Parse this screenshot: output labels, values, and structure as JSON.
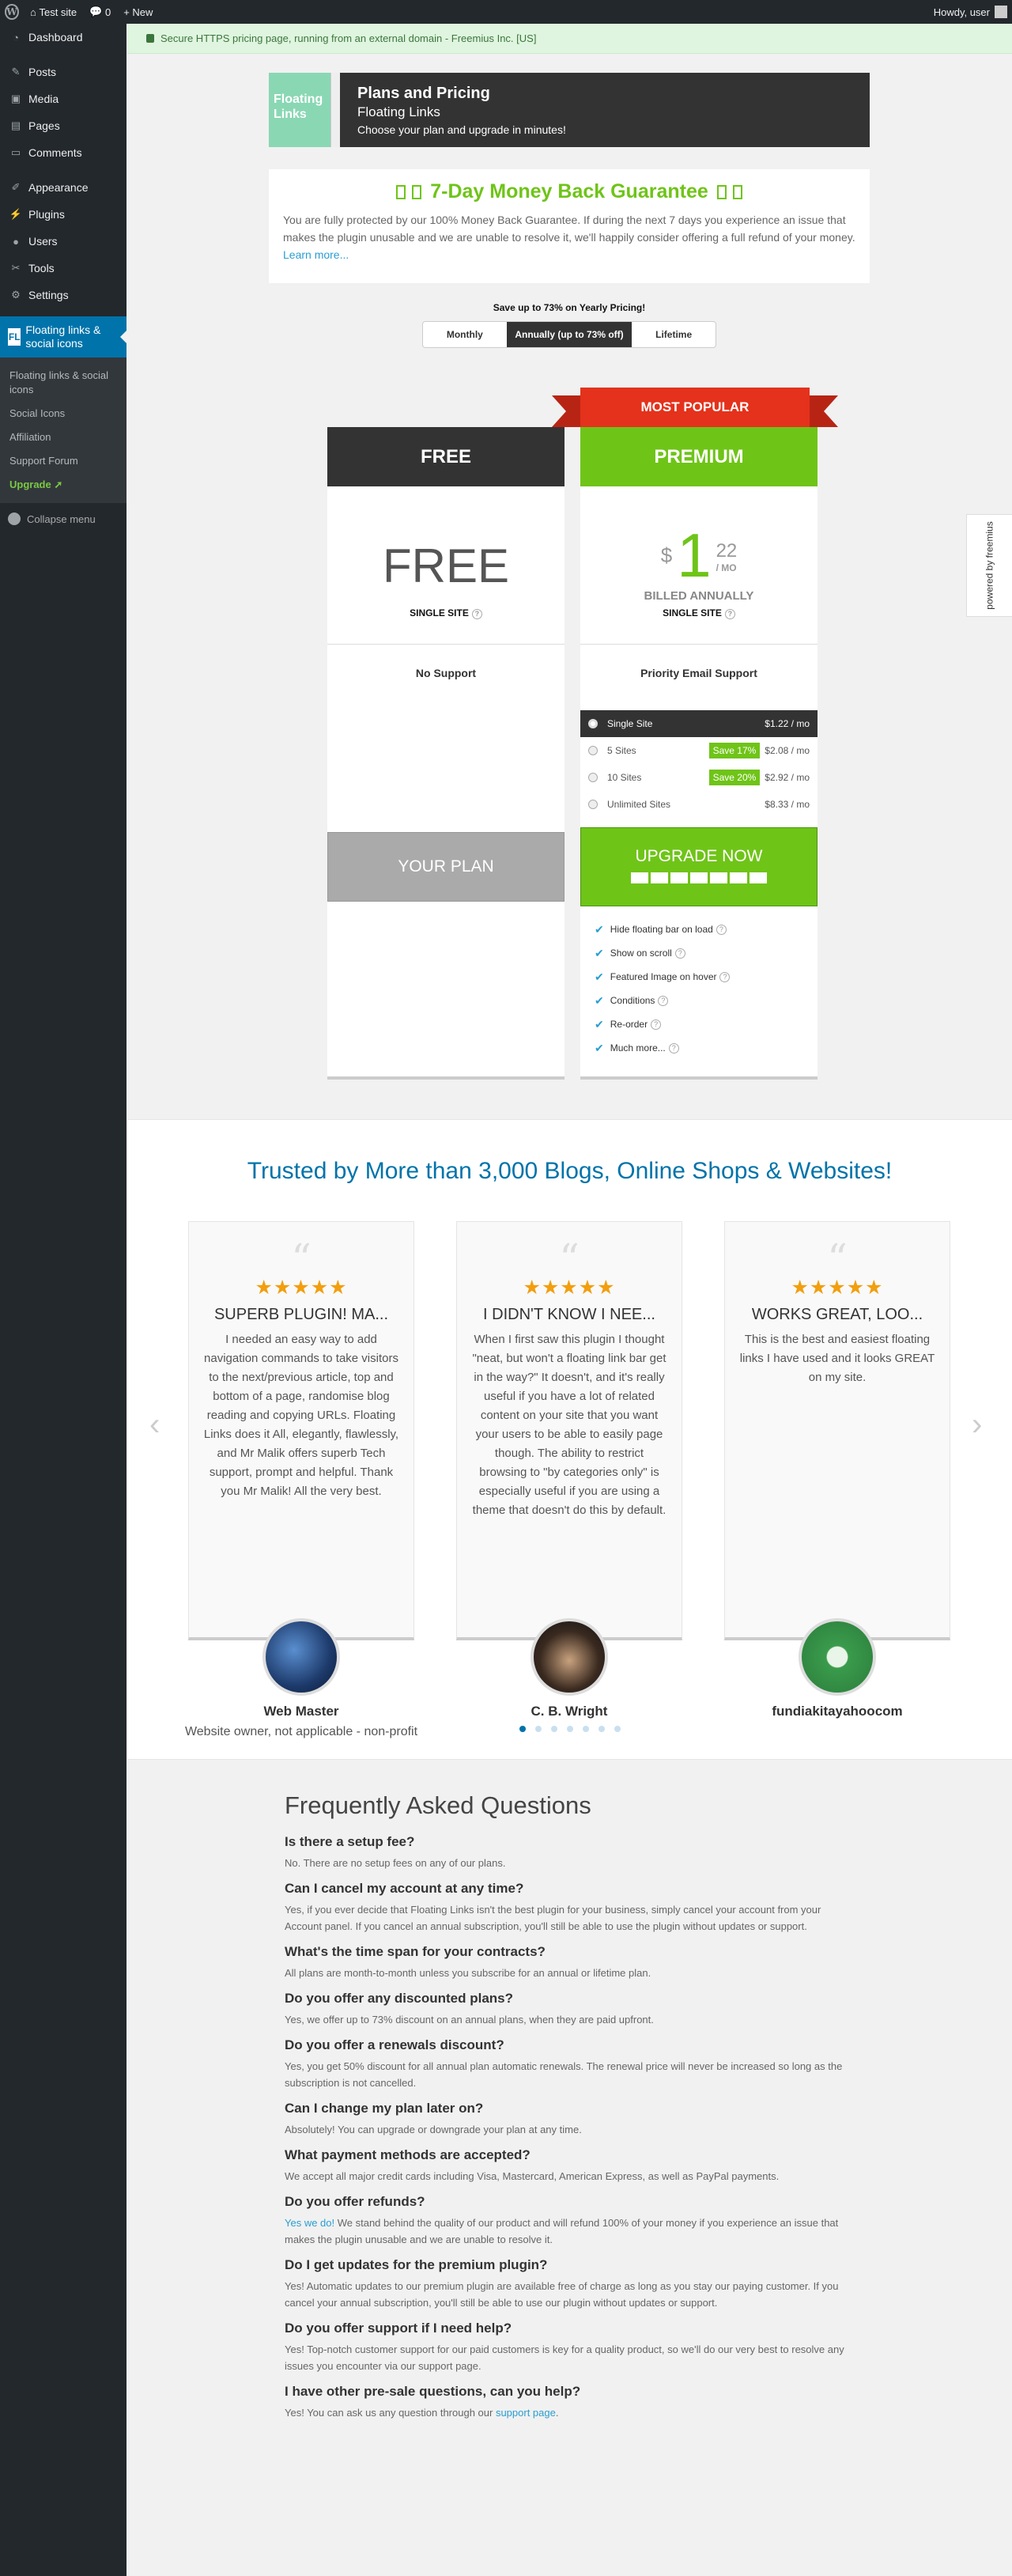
{
  "adminbar": {
    "site": "Test site",
    "comments": "0",
    "new": "New",
    "howdy": "Howdy, user"
  },
  "menu": {
    "dashboard": "Dashboard",
    "posts": "Posts",
    "media": "Media",
    "pages": "Pages",
    "comments": "Comments",
    "appearance": "Appearance",
    "plugins": "Plugins",
    "users": "Users",
    "tools": "Tools",
    "settings": "Settings",
    "fl_icon": "FL",
    "fl_label": "Floating links & social icons",
    "sub": [
      "Floating links & social icons",
      "Social Icons",
      "Affiliation",
      "Support Forum"
    ],
    "upgrade": "Upgrade",
    "collapse": "Collapse menu"
  },
  "secure": "Secure HTTPS pricing page, running from an external domain - Freemius Inc. [US]",
  "header": {
    "logo_text": "Floating Links",
    "title": "Plans and Pricing",
    "subtitle": "Floating Links",
    "tagline": "Choose your plan and upgrade in minutes!"
  },
  "guarantee": {
    "title": "7-Day Money Back Guarantee",
    "text": "You are fully protected by our 100% Money Back Guarantee. If during the next 7 days you experience an issue that makes the plugin unusable and we are unable to resolve it, we'll happily consider offering a full refund of your money.",
    "link": "Learn more..."
  },
  "billing": {
    "save": "Save up to 73% on Yearly Pricing!",
    "options": [
      "Monthly",
      "Annually (up to 73% off)",
      "Lifetime"
    ]
  },
  "ribbon": "MOST POPULAR",
  "free": {
    "name": "FREE",
    "price": "FREE",
    "sites": "SINGLE SITE",
    "support": "No Support",
    "button": "YOUR PLAN"
  },
  "premium": {
    "name": "PREMIUM",
    "currency": "$",
    "price_int": "1",
    "price_dec": "22",
    "per": "/ MO",
    "billed": "BILLED ANNUALLY",
    "sites": "SINGLE SITE",
    "support": "Priority Email Support",
    "button": "UPGRADE NOW",
    "site_options": [
      {
        "name": "Single Site",
        "save": "",
        "price": "$1.22 / mo"
      },
      {
        "name": "5 Sites",
        "save": "Save 17%",
        "price": "$2.08 / mo"
      },
      {
        "name": "10 Sites",
        "save": "Save 20%",
        "price": "$2.92 / mo"
      },
      {
        "name": "Unlimited Sites",
        "save": "",
        "price": "$8.33 / mo"
      }
    ],
    "features": [
      "Hide floating bar on load",
      "Show on scroll",
      "Featured Image on hover",
      "Conditions",
      "Re-order",
      "Much more..."
    ]
  },
  "powered": "powered by freemius",
  "trusted": {
    "title": "Trusted by More than 3,000 Blogs, Online Shops & Websites!",
    "stars": "★★★★★",
    "cards": [
      {
        "title": "SUPERB PLUGIN! MA...",
        "text": "I needed an easy way to add navigation commands to take visitors to the next/previous article, top and bottom of a page, randomise blog reading and copying URLs. Floating Links does it All, elegantly, flawlessly, and Mr Malik offers superb Tech support, prompt and helpful. Thank you Mr Malik! All the very best.",
        "name": "Web Master",
        "sub": "Website owner, not applicable - non-profit"
      },
      {
        "title": "I DIDN'T KNOW I NEE...",
        "text": "When I first saw this plugin I thought \"neat, but won't a floating link bar get in the way?\" It doesn't, and it's really useful if you have a lot of related content on your site that you want your users to be able to easily page though. The ability to restrict browsing to \"by categories only\" is especially useful if you are using a theme that doesn't do this by default.",
        "name": "C. B. Wright",
        "sub": ""
      },
      {
        "title": "WORKS GREAT, LOO...",
        "text": "This is the best and easiest floating links I have used and it looks GREAT on my site.",
        "name": "fundiakitayahoocom",
        "sub": ""
      }
    ]
  },
  "faq": {
    "title": "Frequently Asked Questions",
    "items": [
      {
        "q": "Is there a setup fee?",
        "a": "No. There are no setup fees on any of our plans."
      },
      {
        "q": "Can I cancel my account at any time?",
        "a": "Yes, if you ever decide that Floating Links isn't the best plugin for your business, simply cancel your account from your Account panel. If you cancel an annual subscription, you'll still be able to use the plugin without updates or support."
      },
      {
        "q": "What's the time span for your contracts?",
        "a": "All plans are month-to-month unless you subscribe for an annual or lifetime plan."
      },
      {
        "q": "Do you offer any discounted plans?",
        "a": "Yes, we offer up to 73% discount on an annual plans, when they are paid upfront."
      },
      {
        "q": "Do you offer a renewals discount?",
        "a": "Yes, you get 50% discount for all annual plan automatic renewals. The renewal price will never be increased so long as the subscription is not cancelled."
      },
      {
        "q": "Can I change my plan later on?",
        "a": "Absolutely! You can upgrade or downgrade your plan at any time."
      },
      {
        "q": "What payment methods are accepted?",
        "a": "We accept all major credit cards including Visa, Mastercard, American Express, as well as PayPal payments."
      },
      {
        "q": "Do you offer refunds?",
        "a_link": "Yes we do!",
        "a": " We stand behind the quality of our product and will refund 100% of your money if you experience an issue that makes the plugin unusable and we are unable to resolve it."
      },
      {
        "q": "Do I get updates for the premium plugin?",
        "a": "Yes! Automatic updates to our premium plugin are available free of charge as long as you stay our paying customer. If you cancel your annual subscription, you'll still be able to use our plugin without updates or support."
      },
      {
        "q": "Do you offer support if I need help?",
        "a": "Yes! Top-notch customer support for our paid customers is key for a quality product, so we'll do our very best to resolve any issues you encounter via our support page."
      },
      {
        "q": "I have other pre-sale questions, can you help?",
        "a": "Yes! You can ask us any question through our ",
        "a_link2": "support page",
        "a_end": "."
      }
    ]
  },
  "colors": {
    "accent": "#0073aa",
    "green": "#6fc418",
    "dark": "#333333",
    "ribbon": "#e4321c"
  }
}
